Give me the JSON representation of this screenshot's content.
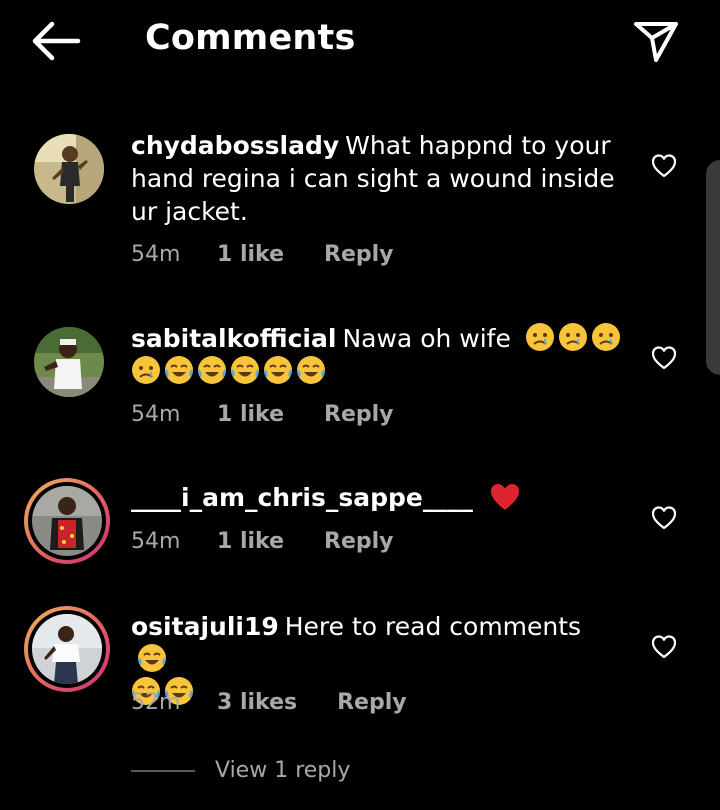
{
  "header": {
    "title": "Comments",
    "back_icon": "arrow-left-icon",
    "share_icon": "paper-plane-icon"
  },
  "comments": [
    {
      "username": "chydabosslady",
      "text": "What happnd to your hand regina i can sight a wound inside ur jacket.",
      "time": "54m",
      "likes": "1 like",
      "reply": "Reply",
      "has_story_ring": false
    },
    {
      "username": "sabitalkofficial",
      "text": "Nawa oh wife",
      "emojis": [
        "crying-face",
        "crying-face",
        "crying-face",
        "crying-face",
        "tears-of-joy",
        "tears-of-joy",
        "tears-of-joy",
        "tears-of-joy",
        "tears-of-joy"
      ],
      "time": "54m",
      "likes": "1 like",
      "reply": "Reply",
      "has_story_ring": false
    },
    {
      "username": "____i_am_chris_sappe____",
      "text": "",
      "emojis": [
        "red-heart"
      ],
      "time": "54m",
      "likes": "1 like",
      "reply": "Reply",
      "has_story_ring": true
    },
    {
      "username": "ositajuli19",
      "text": "Here to read comments",
      "emojis": [
        "tears-of-joy",
        "tears-of-joy",
        "tears-of-joy"
      ],
      "time": "52m",
      "likes": "3 likes",
      "reply": "Reply",
      "has_story_ring": true,
      "view_replies": "View 1 reply"
    }
  ],
  "colors": {
    "background": "#000000",
    "text": "#ffffff",
    "meta": "#a8a8a8",
    "heart_red": "#e0242f",
    "story_ring_start": "#f0b45c",
    "story_ring_end": "#c13584"
  }
}
